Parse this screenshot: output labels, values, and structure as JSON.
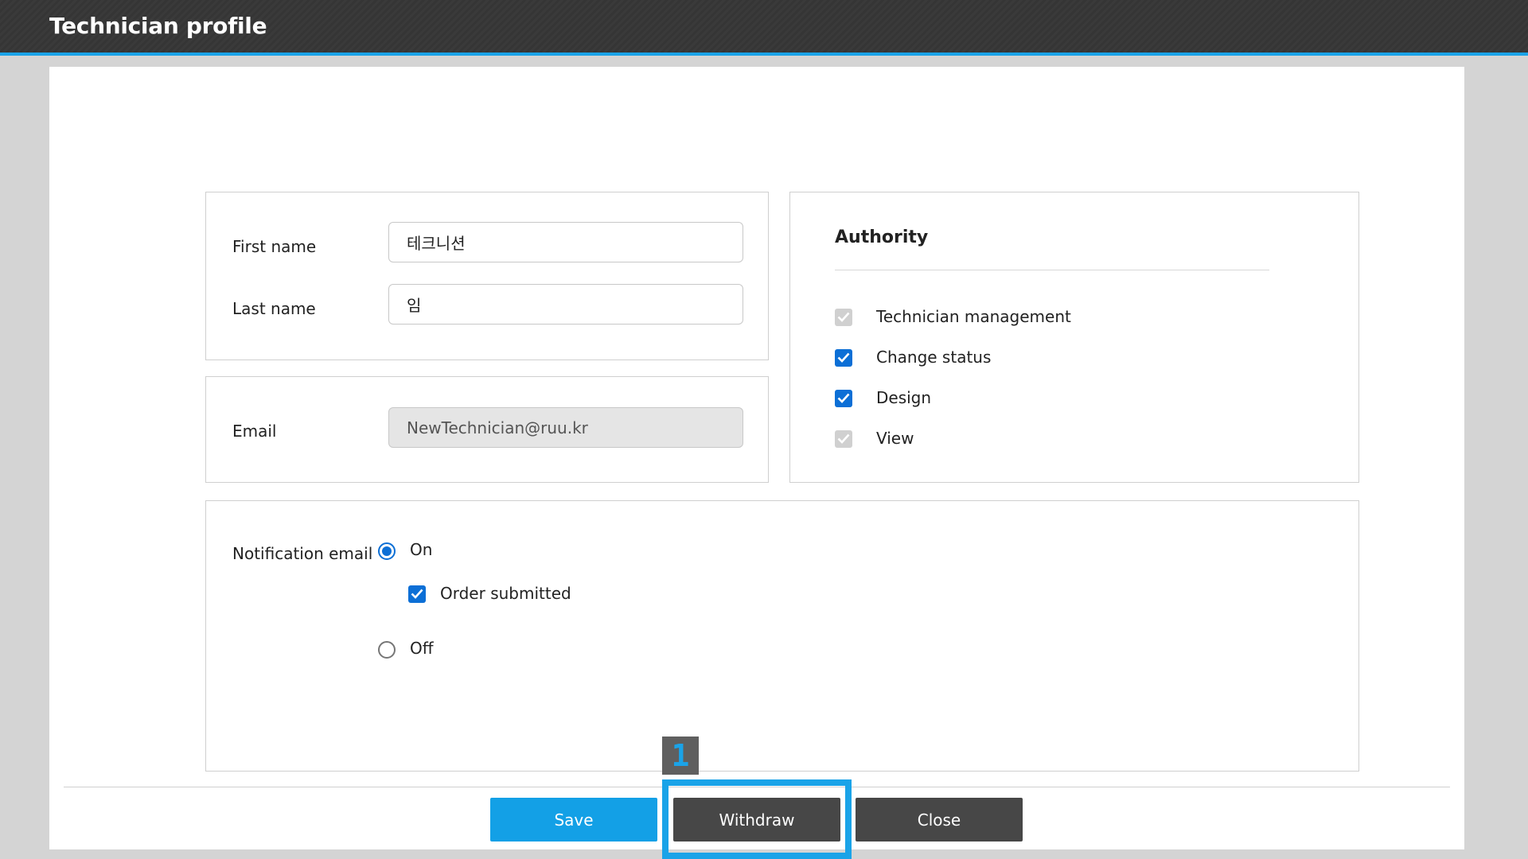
{
  "window": {
    "title": "Technician profile"
  },
  "name_section": {
    "first_name_label": "First name",
    "first_name_value": "테크니션",
    "last_name_label": "Last name",
    "last_name_value": "임"
  },
  "email_section": {
    "email_label": "Email",
    "email_value": "NewTechnician@ruu.kr"
  },
  "authority": {
    "title": "Authority",
    "items": [
      {
        "label": "Technician management",
        "checked": true,
        "disabled": true
      },
      {
        "label": "Change status",
        "checked": true,
        "disabled": false
      },
      {
        "label": "Design",
        "checked": true,
        "disabled": false
      },
      {
        "label": "View",
        "checked": true,
        "disabled": true
      }
    ]
  },
  "notification": {
    "label": "Notification email",
    "on_label": "On",
    "off_label": "Off",
    "selected": "On",
    "order_submitted_label": "Order submitted",
    "order_submitted_checked": true
  },
  "footer": {
    "save_label": "Save",
    "withdraw_label": "Withdraw",
    "close_label": "Close"
  },
  "annotation": {
    "step_number": "1",
    "accent_color": "#1aa3e8"
  },
  "colors": {
    "primary_button": "#13a0e6",
    "dark_button": "#474747",
    "checkbox_checked": "#0c6fd6",
    "checkbox_disabled": "#d0d0d0"
  }
}
